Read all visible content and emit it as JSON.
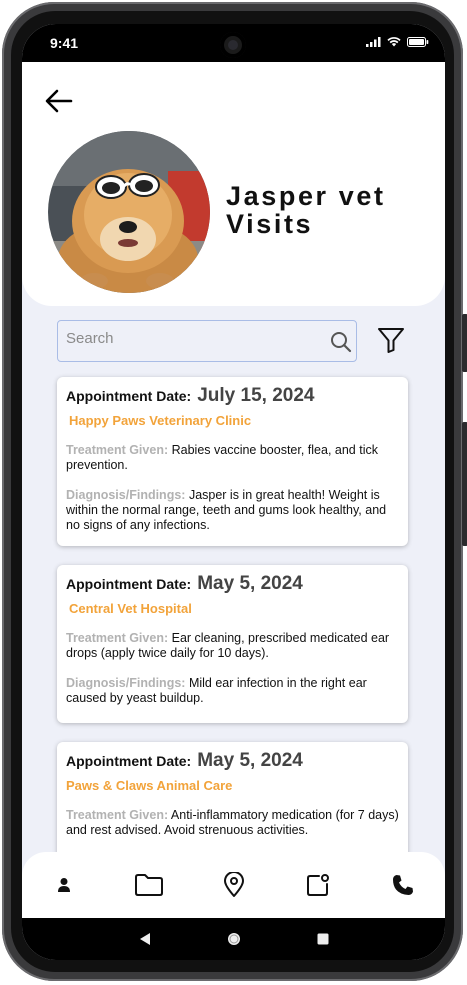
{
  "status_bar": {
    "time": "9:41"
  },
  "header": {
    "title_line1": "Jasper vet",
    "title_line2": "Visits"
  },
  "search": {
    "placeholder": "Search"
  },
  "visits": [
    {
      "date_label": "Appointment Date:",
      "date": "July 15, 2024",
      "clinic": "Happy Paws Veterinary Clinic",
      "treatment_label": "Treatment Given:",
      "treatment": "Rabies vaccine booster, flea, and tick prevention.",
      "diagnosis_label": "Diagnosis/Findings:",
      "diagnosis": "Jasper is in great health! Weight is within the normal range, teeth and gums look healthy, and no signs of any infections."
    },
    {
      "date_label": "Appointment Date:",
      "date": "May 5, 2024",
      "clinic": "Central Vet Hospital",
      "treatment_label": "Treatment Given:",
      "treatment": "Ear cleaning, prescribed medicated ear drops (apply twice daily for 10 days).",
      "diagnosis_label": "Diagnosis/Findings:",
      "diagnosis": "Mild ear infection in the right ear caused by yeast buildup."
    },
    {
      "date_label": "Appointment Date:",
      "date": "May 5, 2024",
      "clinic": "Paws & Claws Animal Care",
      "treatment_label": "Treatment Given:",
      "treatment": "Anti-inflammatory medication (for 7 days) and rest advised. Avoid strenuous activities."
    }
  ],
  "bottom_nav": [
    "person-icon",
    "folder-icon",
    "location-pin-icon",
    "notification-icon",
    "phone-icon"
  ],
  "system_nav": [
    "back-triangle-icon",
    "home-circle-icon",
    "recents-square-icon"
  ],
  "colors": {
    "accent": "#f2a33a",
    "label_gray": "#b2b2b2",
    "screen_bg": "#eef0f8",
    "search_border": "#a9bce6"
  }
}
